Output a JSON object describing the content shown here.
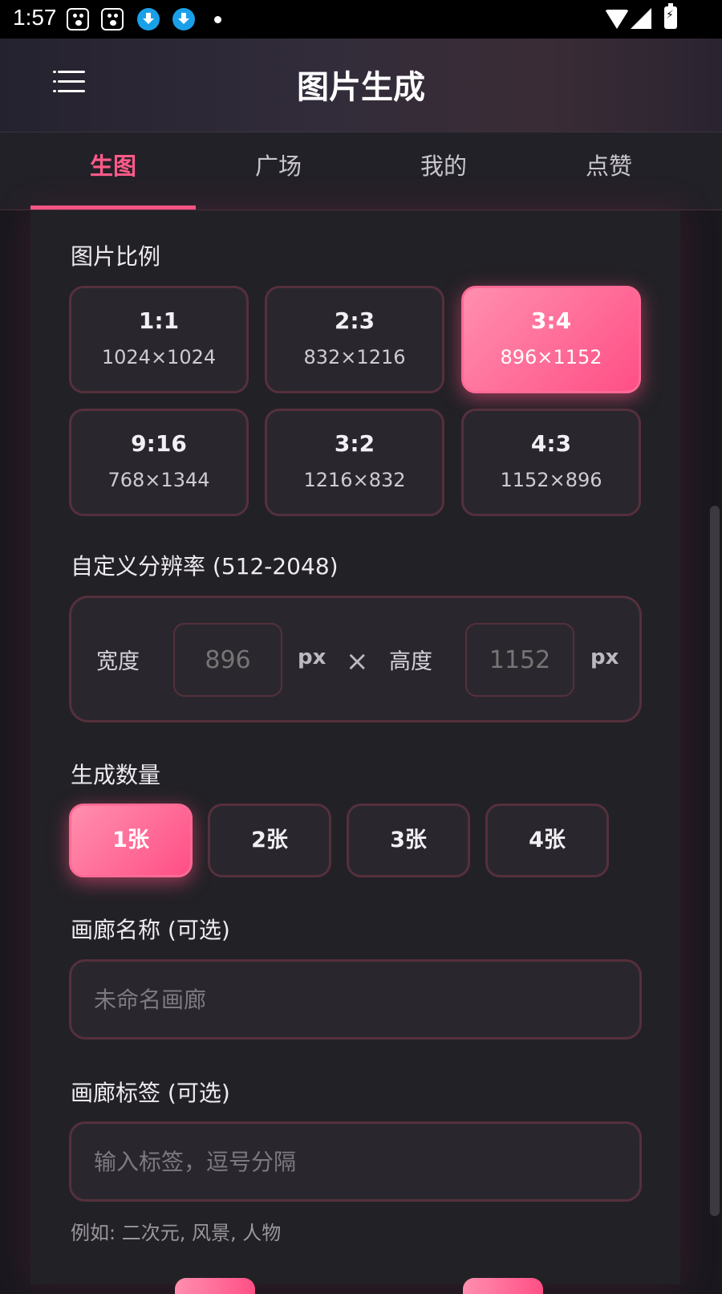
{
  "status_bar": {
    "time": "1:57",
    "icons": [
      "paw-icon",
      "paw-icon",
      "download-icon",
      "download-icon",
      "dot-icon",
      "wifi-icon",
      "cell-signal-icon",
      "battery-charging-icon"
    ]
  },
  "app_bar": {
    "title": "图片生成",
    "menu_icon": "menu-icon"
  },
  "tabs": [
    {
      "label": "生图",
      "active": true
    },
    {
      "label": "广场",
      "active": false
    },
    {
      "label": "我的",
      "active": false
    },
    {
      "label": "点赞",
      "active": false
    }
  ],
  "ratio_section": {
    "label": "图片比例",
    "options": [
      {
        "ratio": "1:1",
        "size": "1024×1024",
        "selected": false
      },
      {
        "ratio": "2:3",
        "size": "832×1216",
        "selected": false
      },
      {
        "ratio": "3:4",
        "size": "896×1152",
        "selected": true
      },
      {
        "ratio": "9:16",
        "size": "768×1344",
        "selected": false
      },
      {
        "ratio": "3:2",
        "size": "1216×832",
        "selected": false
      },
      {
        "ratio": "4:3",
        "size": "1152×896",
        "selected": false
      }
    ]
  },
  "custom_resolution": {
    "label": "自定义分辨率 (512-2048)",
    "width_label": "宽度",
    "width_placeholder": "896",
    "height_label": "高度",
    "height_placeholder": "1152",
    "unit": "px",
    "times": "×"
  },
  "count_section": {
    "label": "生成数量",
    "options": [
      {
        "label": "1张",
        "selected": true
      },
      {
        "label": "2张",
        "selected": false
      },
      {
        "label": "3张",
        "selected": false
      },
      {
        "label": "4张",
        "selected": false
      }
    ]
  },
  "gallery_name": {
    "label": "画廊名称 (可选)",
    "placeholder": "未命名画廊"
  },
  "gallery_tags": {
    "label": "画廊标签 (可选)",
    "placeholder": "输入标签，逗号分隔",
    "hint": "例如: 二次元, 风景, 人物"
  },
  "colors": {
    "accent": "#ff5b8a",
    "background": "#1a181e",
    "card": "#222126",
    "border": "#55303c"
  }
}
